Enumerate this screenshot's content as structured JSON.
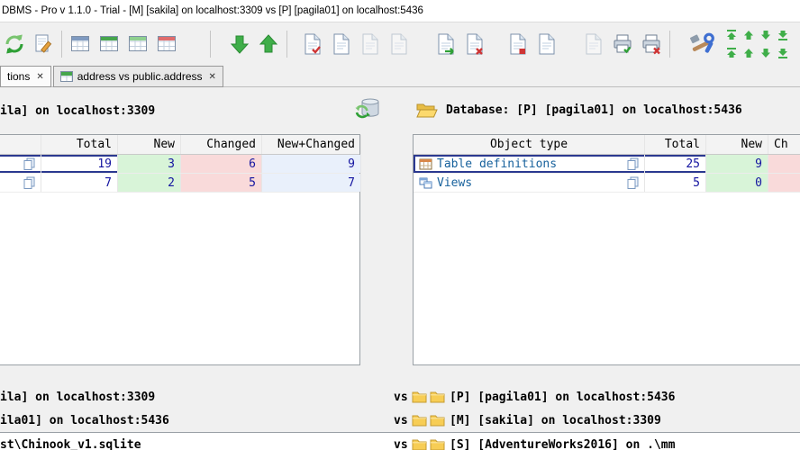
{
  "window": {
    "title": "DBMS - Pro v 1.1.0 - Trial - [M] [sakila] on localhost:3309 vs [P] [pagila01] on localhost:5436"
  },
  "ui": {
    "close_glyph": "✕"
  },
  "tabs": [
    {
      "label": "tions"
    },
    {
      "label": "address vs public.address"
    }
  ],
  "icons": {
    "toolbar": [
      "refresh-icon",
      "document-pencil-icon",
      "table-blue-icon",
      "table-green-icon",
      "table-lightgreen-icon",
      "table-red-icon",
      "green-down-arrow-icon",
      "green-up-arrow-icon",
      "document-red-check-icon",
      "document-icon",
      "document-icon",
      "document-icon",
      "document-green-arrow-icon",
      "document-red-x-icon",
      "document-red-check-icon",
      "document-icon",
      "document-icon",
      "printer-green-check-icon",
      "printer-red-x-icon",
      "tools-icon",
      "first-diff-icon",
      "prev-diff-icon",
      "next-diff-icon",
      "last-diff-icon"
    ],
    "panel": [
      "open-folder-icon",
      "database-refresh-icon"
    ],
    "rows": [
      "table-icon",
      "view-icon",
      "copy-icon"
    ],
    "bottom": [
      "folder-icon"
    ],
    "tabs": [
      "table-compare-icon",
      "close-icon"
    ]
  },
  "left_panel": {
    "title": "ila] on localhost:3309",
    "table": {
      "headers": {
        "object_type": "",
        "total": "Total",
        "new": "New",
        "changed": "Changed",
        "new_changed": "New+Changed"
      },
      "rows": [
        {
          "total": "19",
          "new": "3",
          "changed": "6",
          "new_changed": "9"
        },
        {
          "total": "7",
          "new": "2",
          "changed": "5",
          "new_changed": "7"
        }
      ]
    }
  },
  "right_panel": {
    "title": "Database: [P] [pagila01] on localhost:5436",
    "table": {
      "headers": {
        "object_type": "Object type",
        "total": "Total",
        "new": "New",
        "changed": "Ch"
      },
      "rows": [
        {
          "name": "Table definitions",
          "total": "25",
          "new": "9"
        },
        {
          "name": "Views",
          "total": "5",
          "new": "0"
        }
      ]
    }
  },
  "bottom": {
    "vs": "vs",
    "rows": [
      {
        "left": "ila] on localhost:3309",
        "right": "[P] [pagila01] on localhost:5436"
      },
      {
        "left": "ila01] on localhost:5436",
        "right": "[M] [sakila] on localhost:3309"
      },
      {
        "left": "st\\Chinook_v1.sqlite",
        "right": "[S] [AdventureWorks2016] on .\\mm"
      }
    ]
  },
  "colors": {
    "new_bg": "#d8f4d8",
    "changed_bg": "#f9dada",
    "new_changed_bg": "#e9f0fb",
    "number_text": "#1414a0",
    "object_text": "#17619c",
    "selection_border": "#2b3990",
    "toolbar_green": "#3fae49"
  }
}
